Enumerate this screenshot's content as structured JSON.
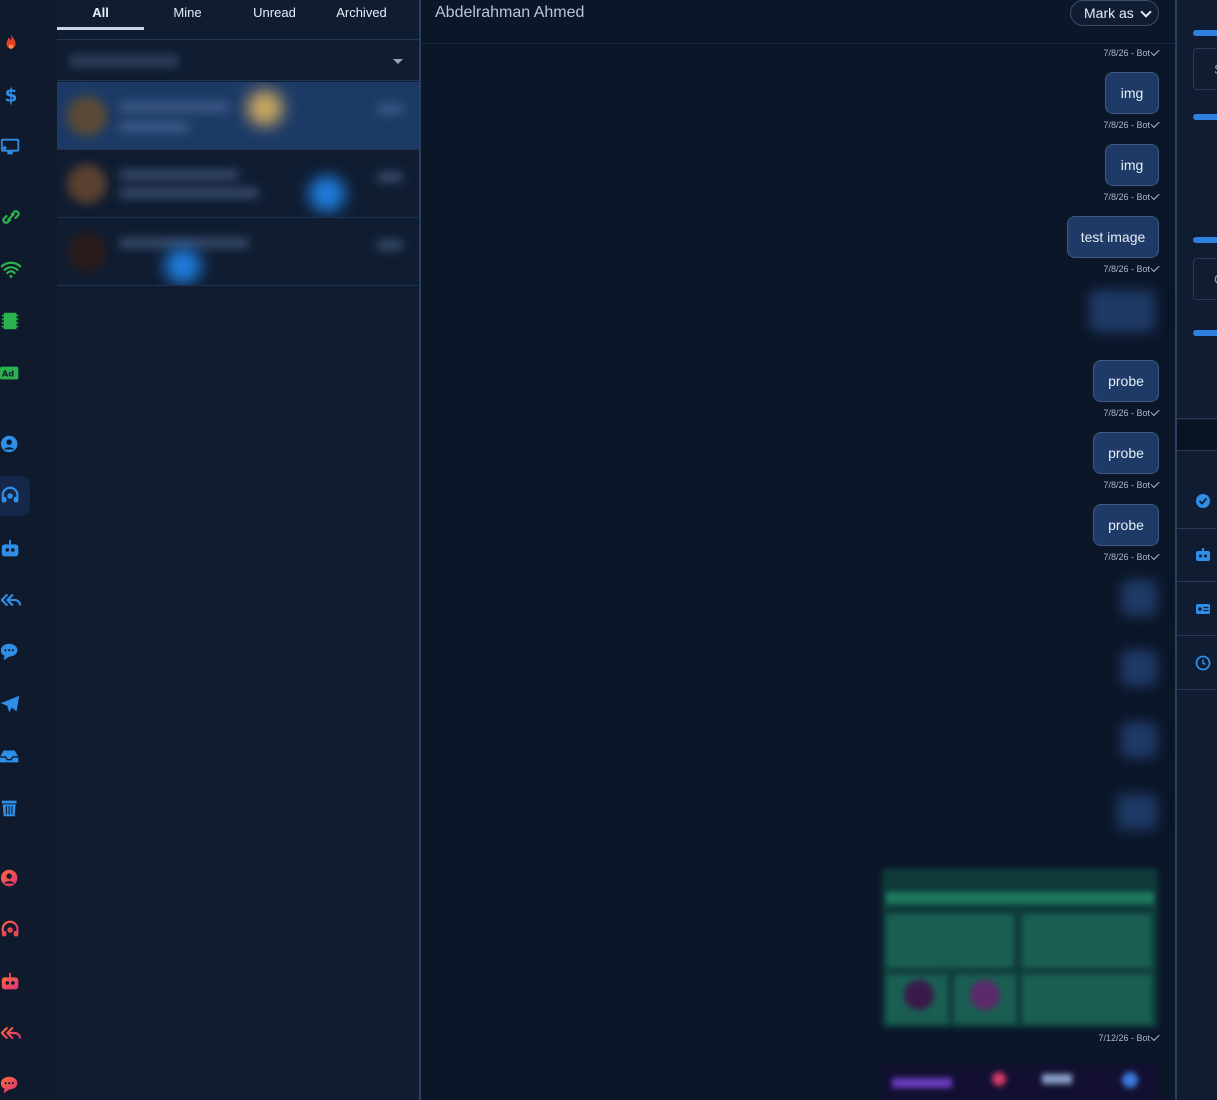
{
  "tabs": [
    {
      "label": "All",
      "active": true
    },
    {
      "label": "Mine",
      "active": false
    },
    {
      "label": "Unread",
      "active": false
    },
    {
      "label": "Archived",
      "active": false
    }
  ],
  "chat": {
    "contact_name": "Abdelrahman Ahmed",
    "mark_as_label": "Mark as",
    "timestamps": {
      "t1": "7/8/26 - Bot",
      "t2": "7/8/26 - Bot",
      "t3": "7/8/26 - Bot",
      "t4": "7/8/26 - Bot",
      "t5": "7/8/26 - Bot",
      "t6": "7/8/26 - Bot",
      "t7": "7/8/26 - Bot",
      "t8": "7/12/26 - Bot"
    },
    "messages": {
      "m1": "img",
      "m2": "img",
      "m3": "test image",
      "m4": "probe",
      "m5": "probe",
      "m6": "probe"
    }
  },
  "right_panel": {
    "input1_partial": "S",
    "input2_partial": "Ch"
  },
  "colors": {
    "accent": "#2f7fe0",
    "bubble": "#1f3a66",
    "selected_row": "#1d3a66"
  },
  "rail_icons": [
    "fire-icon",
    "dollar-icon",
    "monitor-icon",
    "link-icon",
    "wifi-icon",
    "chip-icon",
    "ad-icon",
    "user-circle-icon",
    "headset-icon",
    "robot-icon",
    "reply-all-icon",
    "chat-icon",
    "send-icon",
    "inbox-icon",
    "trash-icon",
    "user-circle-icon",
    "headset-icon",
    "robot-icon",
    "reply-all-icon",
    "chat-icon"
  ]
}
